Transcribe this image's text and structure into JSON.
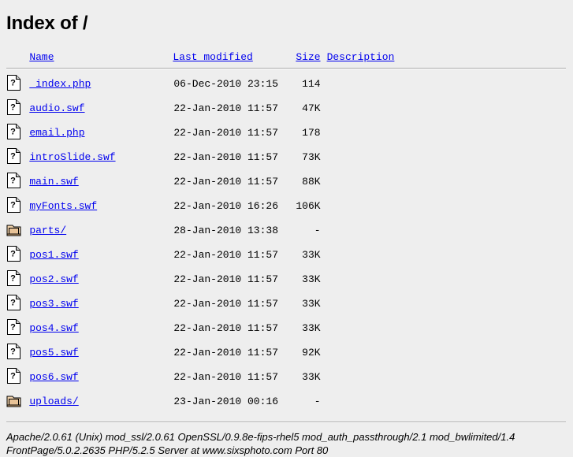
{
  "page": {
    "title": "Index of /",
    "background_color": "#eeeeee",
    "link_color": "#0000ee",
    "text_color": "#000000"
  },
  "table": {
    "headers": {
      "name": "Name",
      "last_modified": "Last modified",
      "size": "Size",
      "description": "Description"
    },
    "rows": [
      {
        "icon": "file-unknown-icon",
        "name": " index.php",
        "last_modified": "06-Dec-2010 23:15",
        "size": "114",
        "description": ""
      },
      {
        "icon": "file-unknown-icon",
        "name": "audio.swf",
        "last_modified": "22-Jan-2010 11:57",
        "size": "47K",
        "description": ""
      },
      {
        "icon": "file-unknown-icon",
        "name": "email.php",
        "last_modified": "22-Jan-2010 11:57",
        "size": "178",
        "description": ""
      },
      {
        "icon": "file-unknown-icon",
        "name": "introSlide.swf",
        "last_modified": "22-Jan-2010 11:57",
        "size": "73K",
        "description": ""
      },
      {
        "icon": "file-unknown-icon",
        "name": "main.swf",
        "last_modified": "22-Jan-2010 11:57",
        "size": "88K",
        "description": ""
      },
      {
        "icon": "file-unknown-icon",
        "name": "myFonts.swf",
        "last_modified": "22-Jan-2010 16:26",
        "size": "106K",
        "description": ""
      },
      {
        "icon": "folder-icon",
        "name": "parts/",
        "last_modified": "28-Jan-2010 13:38",
        "size": "-",
        "description": ""
      },
      {
        "icon": "file-unknown-icon",
        "name": "pos1.swf",
        "last_modified": "22-Jan-2010 11:57",
        "size": "33K",
        "description": ""
      },
      {
        "icon": "file-unknown-icon",
        "name": "pos2.swf",
        "last_modified": "22-Jan-2010 11:57",
        "size": "33K",
        "description": ""
      },
      {
        "icon": "file-unknown-icon",
        "name": "pos3.swf",
        "last_modified": "22-Jan-2010 11:57",
        "size": "33K",
        "description": ""
      },
      {
        "icon": "file-unknown-icon",
        "name": "pos4.swf",
        "last_modified": "22-Jan-2010 11:57",
        "size": "33K",
        "description": ""
      },
      {
        "icon": "file-unknown-icon",
        "name": "pos5.swf",
        "last_modified": "22-Jan-2010 11:57",
        "size": "92K",
        "description": ""
      },
      {
        "icon": "file-unknown-icon",
        "name": "pos6.swf",
        "last_modified": "22-Jan-2010 11:57",
        "size": "33K",
        "description": ""
      },
      {
        "icon": "folder-icon",
        "name": "uploads/",
        "last_modified": "23-Jan-2010 00:16",
        "size": "-",
        "description": ""
      }
    ]
  },
  "footer": {
    "signature": "Apache/2.0.61 (Unix) mod_ssl/2.0.61 OpenSSL/0.9.8e-fips-rhel5 mod_auth_passthrough/2.1 mod_bwlimited/1.4 FrontPage/5.0.2.2635 PHP/5.2.5 Server at www.sixsphoto.com Port 80"
  }
}
